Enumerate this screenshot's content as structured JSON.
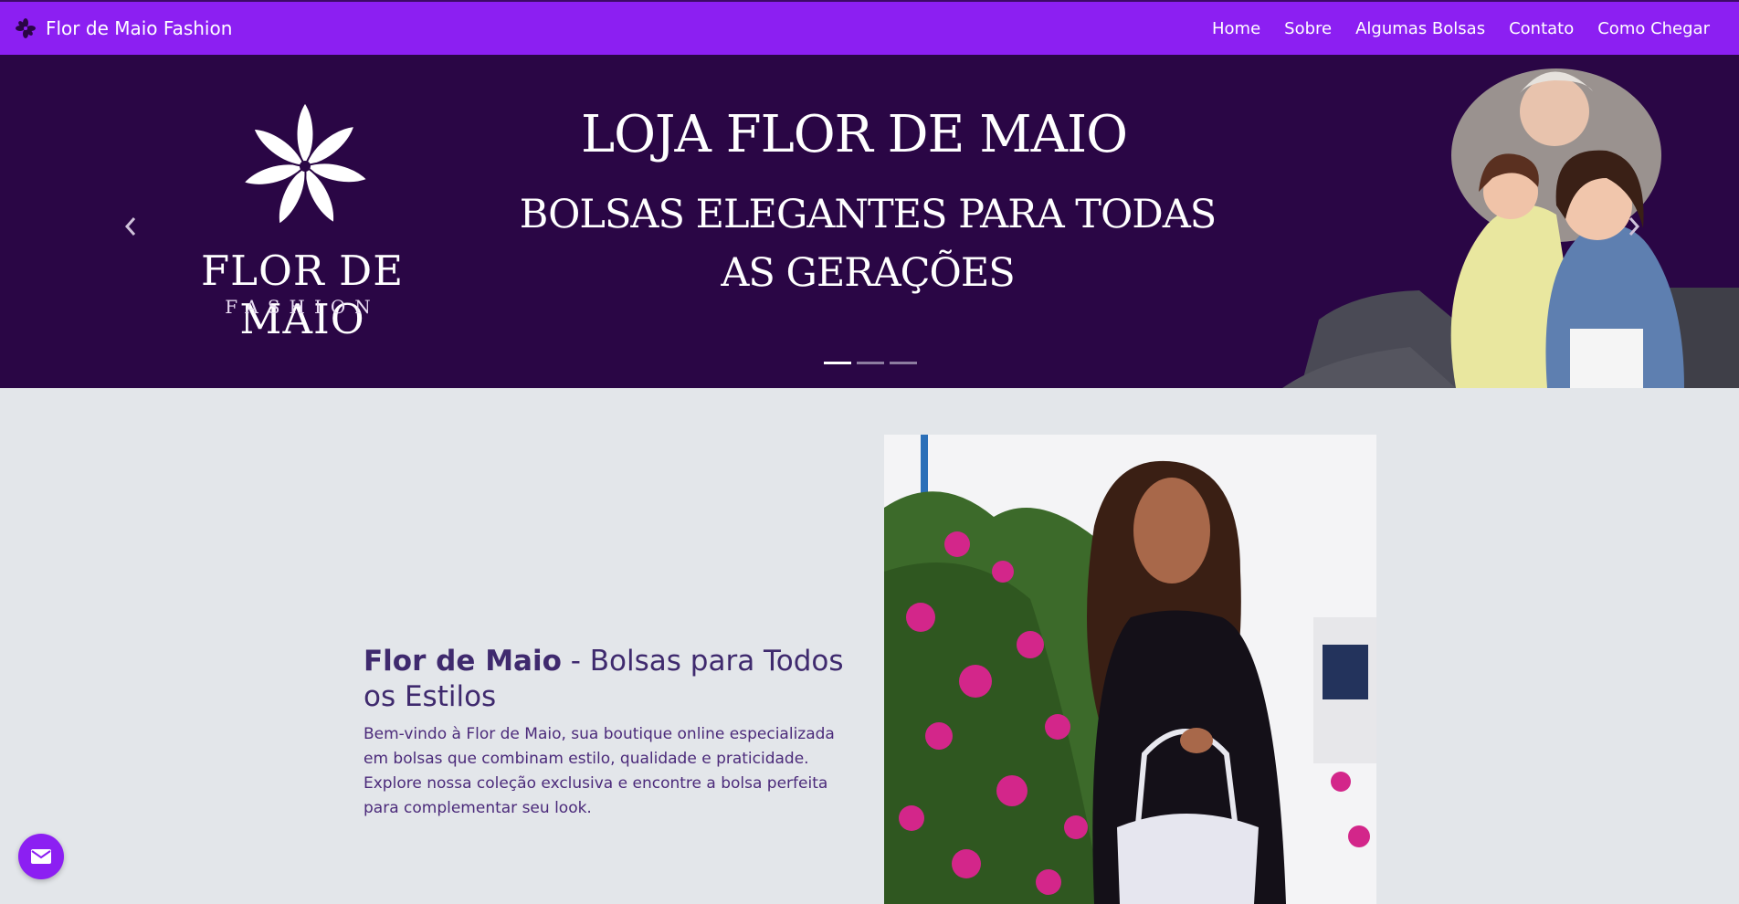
{
  "navbar": {
    "brand": "Flor de Maio Fashion",
    "links": [
      "Home",
      "Sobre",
      "Algumas Bolsas",
      "Contato",
      "Como Chegar"
    ]
  },
  "carousel": {
    "logo_name": "FLOR DE MAIO",
    "logo_sub": "FASHION",
    "title": "LOJA FLOR DE MAIO",
    "subtitle": "BOLSAS ELEGANTES PARA TODAS AS GERAÇÕES",
    "indicator_count": 3,
    "active_indicator": 0
  },
  "intro": {
    "title_bold": "Flor de Maio",
    "title_rest": " - Bolsas para Todos os Estilos",
    "text": "Bem-vindo à Flor de Maio, sua boutique online especializada em bolsas que combinam estilo, qualidade e praticidade. Explore nossa coleção exclusiva e encontre a bolsa perfeita para complementar seu look."
  },
  "colors": {
    "navbar": "#8c1ff2",
    "banner": "#2a0645",
    "page_bg": "#e3e6ea",
    "heading": "#3f2a6e"
  },
  "icons": {
    "brand": "flower-icon",
    "prev": "chevron-left-icon",
    "next": "chevron-right-icon",
    "fab": "envelope-icon"
  }
}
